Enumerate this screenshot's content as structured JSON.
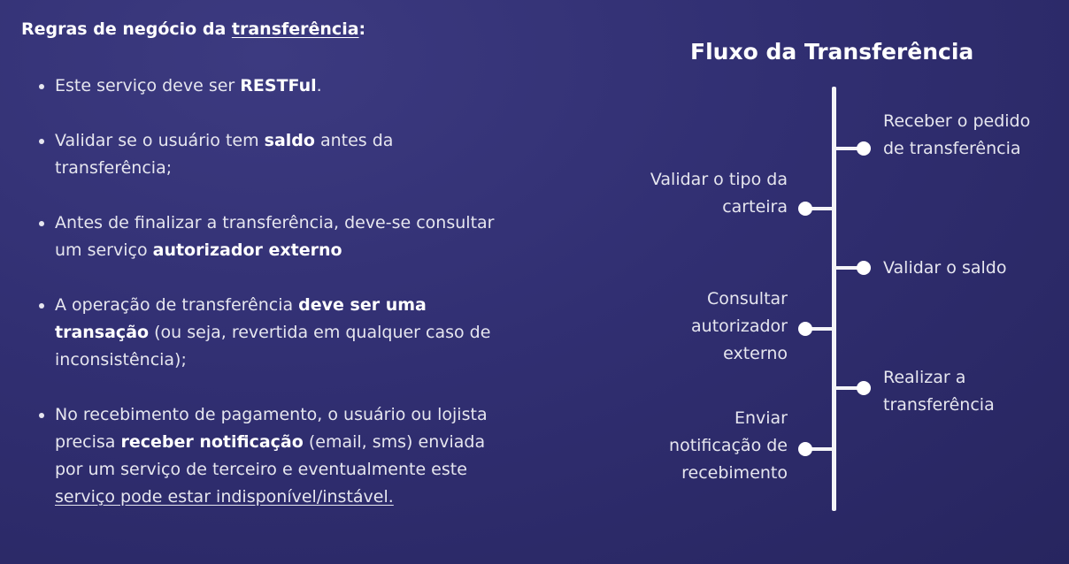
{
  "left": {
    "heading_prefix": "Regras de negócio da ",
    "heading_link": "transferência",
    "heading_suffix": ":",
    "rules": [
      {
        "t1": "Este serviço deve ser ",
        "b1": "RESTFul",
        "t2": "."
      },
      {
        "t1": "Validar se o usuário tem ",
        "b1": "saldo",
        "t2": " antes da transferência;"
      },
      {
        "t1": "Antes de finalizar a transferência, deve-se consultar um serviço ",
        "b1": "autorizador externo",
        "t2": ""
      },
      {
        "t1": "A operação de transferência ",
        "b1": "deve ser uma transação",
        "t2": " (ou seja, revertida em qualquer caso de inconsistência);"
      },
      {
        "t1": "No recebimento de pagamento, o usuário ou lojista precisa ",
        "b1": "receber notificação",
        "t2": " (email, sms) enviada por um serviço de terceiro e eventualmente este ",
        "u1": "serviço pode estar indisponível/instável."
      }
    ]
  },
  "flow": {
    "title": "Fluxo da Transferência",
    "steps": [
      {
        "side": "right",
        "label": "Receber o pedido de transferência"
      },
      {
        "side": "left",
        "label": "Validar o tipo da carteira"
      },
      {
        "side": "right",
        "label": "Validar o saldo"
      },
      {
        "side": "left",
        "label": "Consultar autorizador externo"
      },
      {
        "side": "right",
        "label": "Realizar a transferência"
      },
      {
        "side": "left",
        "label": "Enviar notificação de recebimento"
      }
    ]
  },
  "colors": {
    "background": "#312f72",
    "text": "#e6e6ef",
    "line": "#f4f4f8"
  }
}
